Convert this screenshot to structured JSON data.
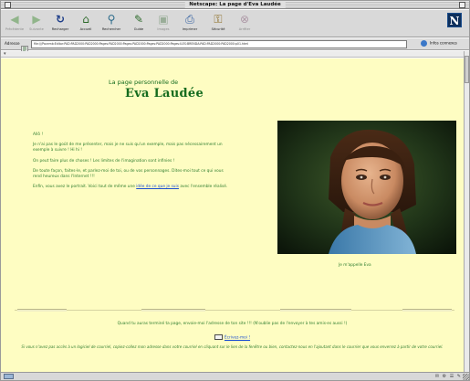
{
  "window": {
    "title": "Netscape: La page d'Eva Laudée"
  },
  "toolbar": {
    "buttons": [
      {
        "label": "Précédente",
        "icon": "back-arrow-icon",
        "enabled": false
      },
      {
        "label": "Suivante",
        "icon": "forward-arrow-icon",
        "enabled": false
      },
      {
        "label": "Recharger",
        "icon": "reload-icon",
        "enabled": true
      },
      {
        "label": "Accueil",
        "icon": "home-icon",
        "enabled": true
      },
      {
        "label": "Rechercher",
        "icon": "search-icon",
        "enabled": true
      },
      {
        "label": "Guide",
        "icon": "guide-icon",
        "enabled": true
      },
      {
        "label": "Images",
        "icon": "images-icon",
        "enabled": false
      },
      {
        "label": "Imprimer",
        "icon": "print-icon",
        "enabled": true
      },
      {
        "label": "Sécurité",
        "icon": "security-icon",
        "enabled": true
      },
      {
        "label": "Arrêter",
        "icon": "stop-icon",
        "enabled": false
      }
    ],
    "logo": "N"
  },
  "location": {
    "label": "Adresse",
    "url": "file:///Pacemb:Editor:PAD:PAD2000:PAD2000:Pages:PAD2000:Pages:PAD2000:Pages:PAD2000:Pages:ILES:BRENDA:PAD:PAD2000:PAD2000:p01.html",
    "related": "Infos connexes"
  },
  "page": {
    "heading_small": "La page personnelle de",
    "heading_big": "Eva Laudée",
    "paragraphs": [
      {
        "text": "Allô !"
      },
      {
        "text": "Je n'ai pas le goût de me présenter, mais je ne suis qu'un exemple, mais pas nécessairement un exemple à suivre ! Hi hi !"
      },
      {
        "text": "On peut faire plus de choses ! Les limites de l'imagination sont infinies !"
      },
      {
        "text": "De toute façon, faites-le, et parlez-moi de toi, ou de vos personnages. Dites-moi tout ce qui vous rend heureux dans l'Internet !!!"
      },
      {
        "text": "Enfin, vous avez le portrait. Voici tout de même une ",
        "link": "idée de ce que je suis",
        "after": " avec l'ensemble réalisé."
      }
    ],
    "photo_caption": "Je m'appelle Eva",
    "footer_line": "Quand tu auras terminé ta page, envoie-moi l'adresse de ton site !!! (N'oublie pas de l'envoyer à tes amis·es aussi !)",
    "footer_link": "Écrivez-moi !",
    "footer_note": "Si vous n'avez pas accès à un logiciel de courriel, copiez-collez mon adresse dans votre courriel en cliquant sur le lien de la fenêtre ou bien, contactez-nous en l'ajoutant dans le courrier que vous enverrez à partir de votre courriel."
  },
  "colors": {
    "page_background": "#fefdc2",
    "heading_green": "#146b1e",
    "text_green": "#2f7d2f",
    "link_blue": "#1d4fd1"
  }
}
